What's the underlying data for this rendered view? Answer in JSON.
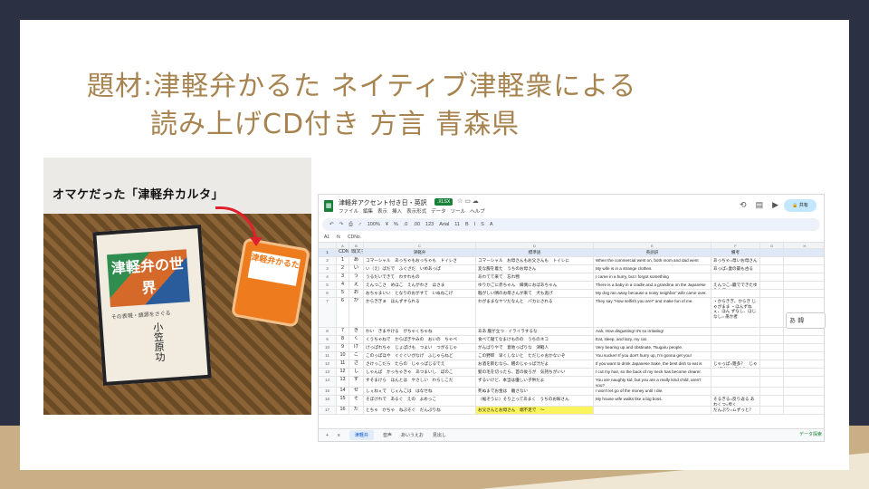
{
  "slide": {
    "title_line1": "題材:津軽弁かるた ネイティブ津軽衆による",
    "title_line2": "読み上げCD付き 方言 青森県"
  },
  "photo": {
    "caption": "オマケだった「津軽弁カルタ」",
    "book_title": "津軽弁の世界",
    "book_subtitle": "その表現・語源をさぐる",
    "book_author": "小笠原功",
    "box_label": "津軽弁かるた"
  },
  "sheet": {
    "doc_title": "津軽弁アクセント付き日・英訳",
    "badge": ".XLSX",
    "menu": [
      "ファイル",
      "編集",
      "表示",
      "挿入",
      "表示形式",
      "データ",
      "ツール",
      "ヘルプ"
    ],
    "share_label": "共有",
    "toolbar": [
      "5",
      "♂",
      "100%",
      "¥",
      "%",
      ".0",
      ".00",
      "123",
      "Arial",
      "11",
      "B",
      "I",
      "S",
      "A"
    ],
    "cell_ref": "A1",
    "formula": "CDNo.",
    "col_letters": [
      "A",
      "B",
      "C",
      "D",
      "E",
      "F",
      "G",
      "H"
    ],
    "headers": [
      "CDNo.",
      "頭文字",
      "津軽弁",
      "標準語",
      "英語訳",
      "備考",
      "",
      ""
    ],
    "rows": [
      {
        "n": "2",
        "cd": "1",
        "k": "あ",
        "tg": "コマーシャル　あっちゃもおっちゃも　ドイレさ",
        "std": "コマーシャル　お母さんもお父さんも　トイレに",
        "en": "When the commercial went on, both mom and dad went",
        "note": "あっちゃ=母いお母さん"
      },
      {
        "n": "3",
        "cd": "2",
        "k": "い",
        "tg": "い（え）ばだで　ふぐざだ　いめあっぱ",
        "std": "変な服を着た　うちのお母さん",
        "en": "My wife is in a strange clothes.",
        "note": "あっぱ=妻の最も古る"
      },
      {
        "n": "4",
        "cd": "3",
        "k": "う",
        "tg": "うるだいできて　わすれもの",
        "std": "あわてて来て　忘れ物",
        "en": "I came in a hurry, but I forgot something",
        "note": ""
      },
      {
        "n": "5",
        "cd": "4",
        "k": "え",
        "tg": "えんつこさ　めほこ　えんがわさ　ほさま",
        "std": "ゆりかごに赤ちゃん　縁側におばあちゃん",
        "en": "There is a baby in a cradle and a grandma on the Japanese",
        "note": "えんつこ=籠でできたゆりかご"
      },
      {
        "n": "6",
        "cd": "5",
        "k": "お",
        "tg": "おちゃまいい　となりのおがすて　いぬねこげ",
        "std": "騒がしい隣のお母さんが来て　犬も逃げ",
        "en": "My dog ran away because a noisy neighbor' wife came over.",
        "note": ""
      },
      {
        "n": "7",
        "cd": "6",
        "k": "か",
        "tg": "からきぎぁ　ほんずすられる",
        "std": "わがままなヤツだなんと　バカにされる",
        "en": "They say \"How selfish you are!\" and make fun of me.",
        "note": "・からきぎ、からき じゃがまま ・ほんずねぇ、ほん ずなし、ほじなし= 愚か者"
      },
      {
        "n": "8",
        "cd": "7",
        "k": "き",
        "tg": "わい　きまやける　がちゃくちゃね",
        "std": "ああ 腹が立つ　イライラするな",
        "en": "Aah, How disgusting! It's so irritating!",
        "note": ""
      },
      {
        "n": "9",
        "cd": "8",
        "k": "く",
        "tg": "くうちゃねで　からぽぎやみの　おいの　ちゃペ",
        "std": "食べて寝てなまけものの　うちのネコ",
        "en": "Eat, sleep, and lazy, my cat.",
        "note": ""
      },
      {
        "n": "10",
        "cd": "9",
        "k": "け",
        "tg": "けっぱれちゃ　じょぱけも　つよい　つがるじゃ",
        "std": "がんばりやで　意地っぱりな　津軽人",
        "en": "Very bearing up and obstinate, Tsugaru people.",
        "note": ""
      },
      {
        "n": "11",
        "cd": "10",
        "k": "こ",
        "tg": "このっぽほや　ぐぐぐいがなげ　ふじゃらねど",
        "std": "この野郎　早くしないと　ただじゃおかないぞ",
        "en": "You sucker! If you don't hurry up, I'm gonna get you!",
        "note": ""
      },
      {
        "n": "12",
        "cd": "11",
        "k": "さ",
        "tg": "さけっこだら　たらの　じゃっぱじるでえ",
        "std": "お酒を飲むなら、鱈のじゃっぱ汁だよ",
        "en": "If you want to drink Japanese Sake, the best dish to eat is",
        "note": "じゃっぱ=雑多？　じゃっぱ汁はいろんな"
      },
      {
        "n": "13",
        "cd": "12",
        "k": "し",
        "tg": "しゃんぱ　かっちゃきゃ　あつまいし　ぼのこ",
        "std": "髪の毛を切ったら、首の後ろが　気持ちがいい",
        "en": "I cut my hair, so the back of my neck has become clearer.",
        "note": ""
      },
      {
        "n": "14",
        "cd": "13",
        "k": "す",
        "tg": "すそまけら　ほんとは　やさしい　わらしこだ",
        "std": "ずるいけど、本当は優しい子供だよ",
        "en": "You are naughty kid, but you are a really kind child, aren't you?",
        "note": ""
      },
      {
        "n": "15",
        "cd": "14",
        "k": "せ",
        "tg": "しぇねぇで　じぇんこは　はなせね",
        "std": "死ぬまでお金は　離さない",
        "en": "I won't let go of the money until I die.",
        "note": ""
      },
      {
        "n": "16",
        "cd": "15",
        "k": "そ",
        "tg": "そぼけれで　あるぐ　えの　よめっこ",
        "std": "（裾ぞうに）そり上ってあまく　うちのお嫁さん",
        "en": "My house wife walks like a big boss.",
        "note": "そるぎる=反り返る あわくつ=歩く"
      },
      {
        "n": "17",
        "cd": "16",
        "k": "た",
        "tg": "とちゃ　かちゃ　ねぷそぐ　だんぷりね",
        "std": "お父さんとお母さん　端不足で　～",
        "en": "",
        "note": "だんぷり=ムずっと？"
      }
    ],
    "tabs": [
      "津軽弁",
      "音声",
      "あいうえお",
      "見出し"
    ],
    "explore_label": "データ探索",
    "floating_text": "あ 韓"
  }
}
